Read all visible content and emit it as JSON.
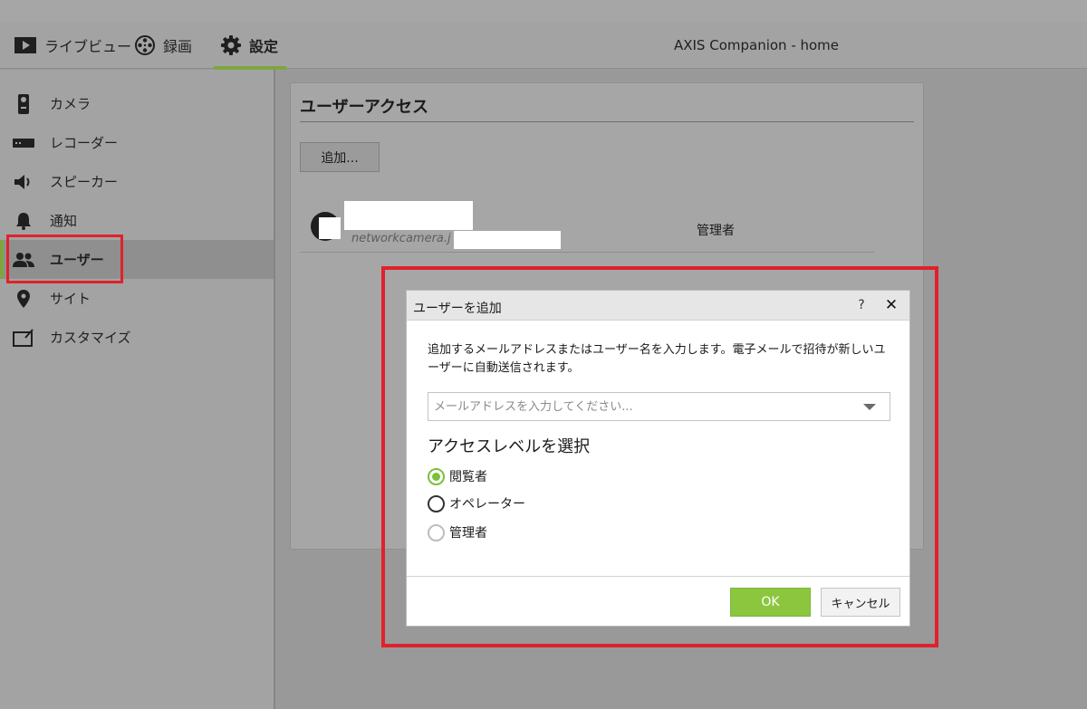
{
  "app": {
    "title": "AXIS Companion - home"
  },
  "nav": {
    "tabs": [
      {
        "label": "ライブビュー",
        "icon": "play-icon"
      },
      {
        "label": "録画",
        "icon": "film-reel-icon"
      },
      {
        "label": "設定",
        "icon": "gear-icon",
        "active": true
      }
    ]
  },
  "sidebar": {
    "items": [
      {
        "label": "カメラ",
        "icon": "camera-icon"
      },
      {
        "label": "レコーダー",
        "icon": "recorder-icon"
      },
      {
        "label": "スピーカー",
        "icon": "speaker-icon"
      },
      {
        "label": "通知",
        "icon": "bell-icon"
      },
      {
        "label": "ユーザー",
        "icon": "users-icon",
        "active": true
      },
      {
        "label": "サイト",
        "icon": "location-pin-icon"
      },
      {
        "label": "カスタマイズ",
        "icon": "customize-icon"
      }
    ]
  },
  "panel": {
    "title": "ユーザーアクセス",
    "add_button": "追加...",
    "users": [
      {
        "email_prefix": "networkcamera.j",
        "role": "管理者"
      }
    ]
  },
  "dialog": {
    "title": "ユーザーを追加",
    "help": "?",
    "close": "✕",
    "description": "追加するメールアドレスまたはユーザー名を入力します。電子メールで招待が新しいユーザーに自動送信されます。",
    "email_placeholder": "メールアドレスを入力してください...",
    "access_heading": "アクセスレベルを選択",
    "options": [
      {
        "label": "閲覧者",
        "selected": true
      },
      {
        "label": "オペレーター",
        "selected": false
      },
      {
        "label": "管理者",
        "selected": false
      }
    ],
    "ok": "OK",
    "cancel": "キャンセル"
  },
  "colors": {
    "accent_green": "#8cc63f",
    "annotation_red": "#e0212b"
  }
}
